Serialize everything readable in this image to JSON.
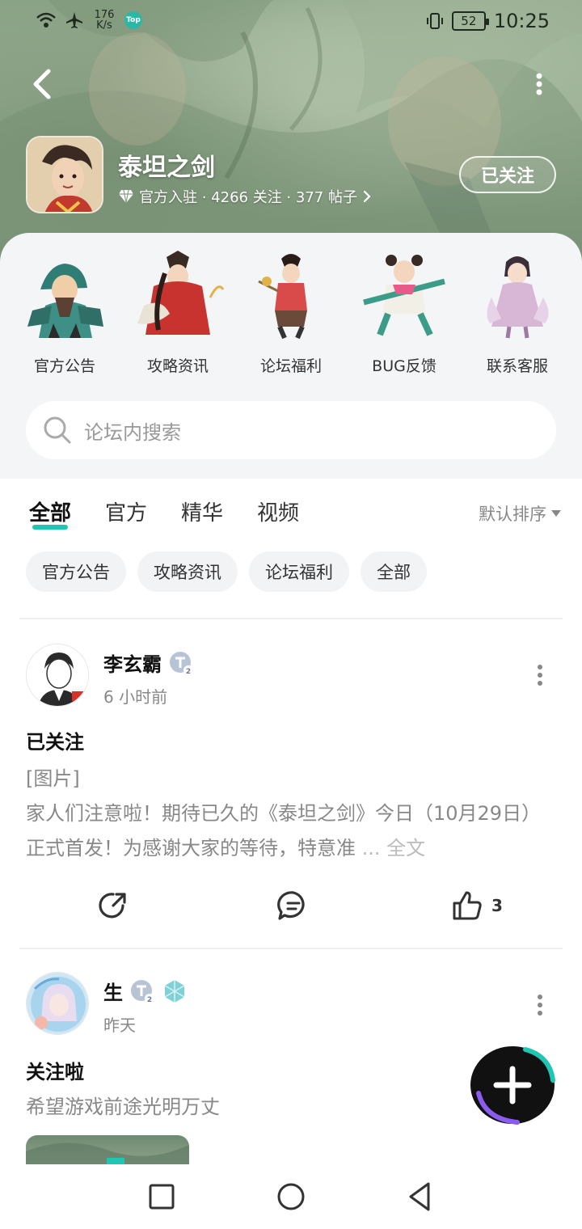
{
  "status_bar": {
    "speed_value": "176",
    "speed_unit": "K/s",
    "badge": "Top",
    "battery": "52",
    "time": "10:25"
  },
  "header": {
    "game_title": "泰坦之剑",
    "meta": "官方入驻 · 4266 关注 · 377 帖子",
    "follow_label": "已关注"
  },
  "shortcuts": [
    {
      "label": "官方公告"
    },
    {
      "label": "攻略资讯"
    },
    {
      "label": "论坛福利"
    },
    {
      "label": "BUG反馈"
    },
    {
      "label": "联系客服"
    }
  ],
  "search": {
    "placeholder": "论坛内搜索"
  },
  "tabs": [
    {
      "label": "全部",
      "active": true
    },
    {
      "label": "官方"
    },
    {
      "label": "精华"
    },
    {
      "label": "视频"
    }
  ],
  "sort_label": "默认排序",
  "chips": [
    "官方公告",
    "攻略资讯",
    "论坛福利",
    "全部"
  ],
  "posts": [
    {
      "author": "李玄霸",
      "time": "6 小时前",
      "title": "已关注",
      "body_tag": "[图片]",
      "body": "家人们注意啦！期待已久的《泰坦之剑》今日（10月29日）正式首发！为感谢大家的等待，特意准",
      "ellipsis": "... 全文",
      "likes": "3"
    },
    {
      "author": "生",
      "time": "昨天",
      "title": "关注啦",
      "body": "希望游戏前途光明万丈"
    }
  ],
  "colors": {
    "accent": "#1fc6b3",
    "banner": "#8aa285"
  }
}
